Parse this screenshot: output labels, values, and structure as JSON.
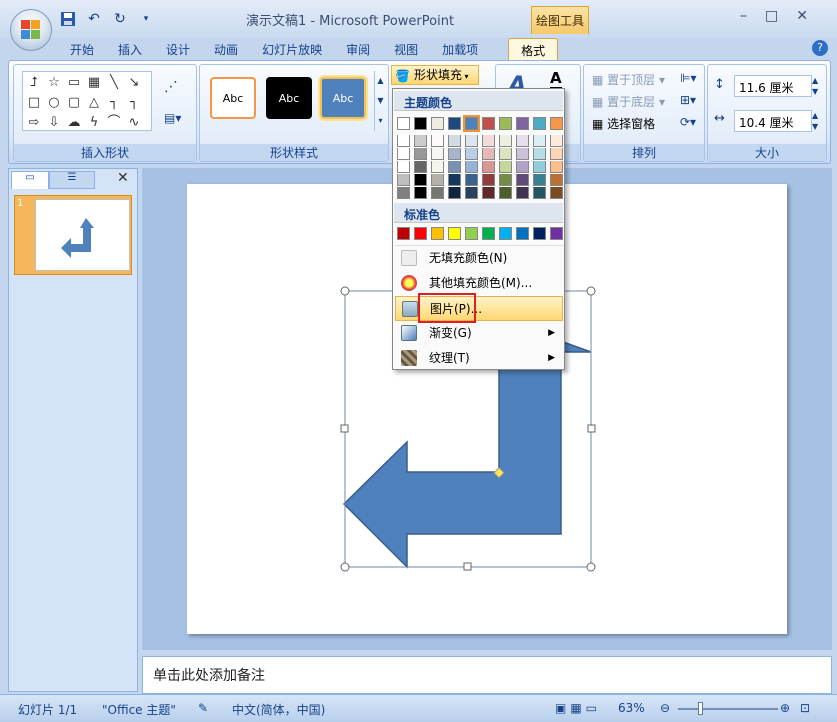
{
  "window": {
    "title": "演示文稿1 - Microsoft PowerPoint",
    "context_tab": "绘图工具"
  },
  "tabs": [
    "开始",
    "插入",
    "设计",
    "动画",
    "幻灯片放映",
    "审阅",
    "视图",
    "加载项",
    "格式"
  ],
  "ribbon": {
    "groups": {
      "insert_shapes": "插入形状",
      "shape_styles": "形状样式",
      "arrange": "排列",
      "size": "大小"
    },
    "style_thumbs": [
      "Abc",
      "Abc",
      "Abc"
    ],
    "shape_fill_label": "形状填充",
    "arrange_items": [
      "置于顶层",
      "置于底层",
      "选择窗格"
    ],
    "height_value": "11.6 厘米",
    "width_value": "10.4 厘米"
  },
  "menu": {
    "theme_colors_header": "主题颜色",
    "standard_colors_header": "标准色",
    "items": [
      "无填充颜色(N)",
      "其他填充颜色(M)...",
      "图片(P)...",
      "渐变(G)",
      "纹理(T)"
    ],
    "theme_colors": [
      "#ffffff",
      "#000000",
      "#eeece1",
      "#1f497d",
      "#4f81bd",
      "#c0504d",
      "#9bbb59",
      "#8064a2",
      "#4bacc6",
      "#f79646"
    ],
    "standard_colors": [
      "#c00000",
      "#ff0000",
      "#ffc000",
      "#ffff00",
      "#92d050",
      "#00b050",
      "#00b0f0",
      "#0070c0",
      "#002060",
      "#7030a0"
    ]
  },
  "left_panel": {
    "slide_number": "1"
  },
  "notes": {
    "placeholder": "单击此处添加备注"
  },
  "status": {
    "slide": "幻灯片 1/1",
    "theme": "\"Office 主题\"",
    "language": "中文(简体，中国)",
    "zoom": "63%"
  },
  "colors": {
    "arrow_fill": "#4f81bd",
    "arrow_stroke": "#385d8a"
  }
}
